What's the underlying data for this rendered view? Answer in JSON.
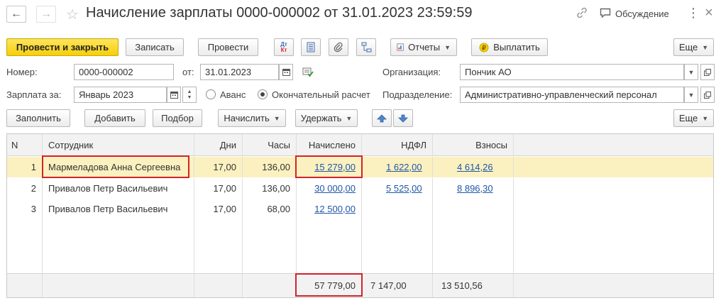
{
  "header": {
    "title": "Начисление зарплаты 0000-000002 от 31.01.2023 23:59:59",
    "discussion": "Обсуждение"
  },
  "toolbar": {
    "post_close": "Провести и закрыть",
    "save": "Записать",
    "post": "Провести",
    "dtkt_dt": "Дт",
    "dtkt_kt": "Кт",
    "reports": "Отчеты",
    "pay": "Выплатить",
    "more": "Еще"
  },
  "form": {
    "number_label": "Номер:",
    "number_value": "0000-000002",
    "date_label": "от:",
    "date_value": "31.01.2023",
    "org_label": "Организация:",
    "org_value": "Пончик АО",
    "period_label": "Зарплата за:",
    "period_value": "Январь 2023",
    "advance_label": "Аванс",
    "final_label": "Окончательный расчет",
    "dept_label": "Подразделение:",
    "dept_value": "Административно-управленческий персонал"
  },
  "tabletoolbar": {
    "fill": "Заполнить",
    "add": "Добавить",
    "select": "Подбор",
    "accrue": "Начислить",
    "withhold": "Удержать",
    "more": "Еще"
  },
  "table": {
    "headers": [
      "N",
      "Сотрудник",
      "Дни",
      "Часы",
      "Начислено",
      "НДФЛ",
      "Взносы"
    ],
    "rows": [
      {
        "n": "1",
        "employee": "Мармеладова Анна Сергеевна",
        "days": "17,00",
        "hours": "136,00",
        "accrued": "15 279,00",
        "ndfl": "1 622,00",
        "contrib": "4 614,26"
      },
      {
        "n": "2",
        "employee": "Привалов Петр Васильевич",
        "days": "17,00",
        "hours": "136,00",
        "accrued": "30 000,00",
        "ndfl": "5 525,00",
        "contrib": "8 896,30"
      },
      {
        "n": "3",
        "employee": "Привалов Петр Васильевич",
        "days": "17,00",
        "hours": "68,00",
        "accrued": "12 500,00",
        "ndfl": "",
        "contrib": ""
      }
    ],
    "totals": {
      "accrued": "57 779,00",
      "ndfl": "7 147,00",
      "contrib": "13 510,56"
    }
  },
  "colors": {
    "primary": "#f5cf0b",
    "selected_row": "#fbf1c0",
    "link": "#1f56a8",
    "highlight": "#d2232a"
  }
}
